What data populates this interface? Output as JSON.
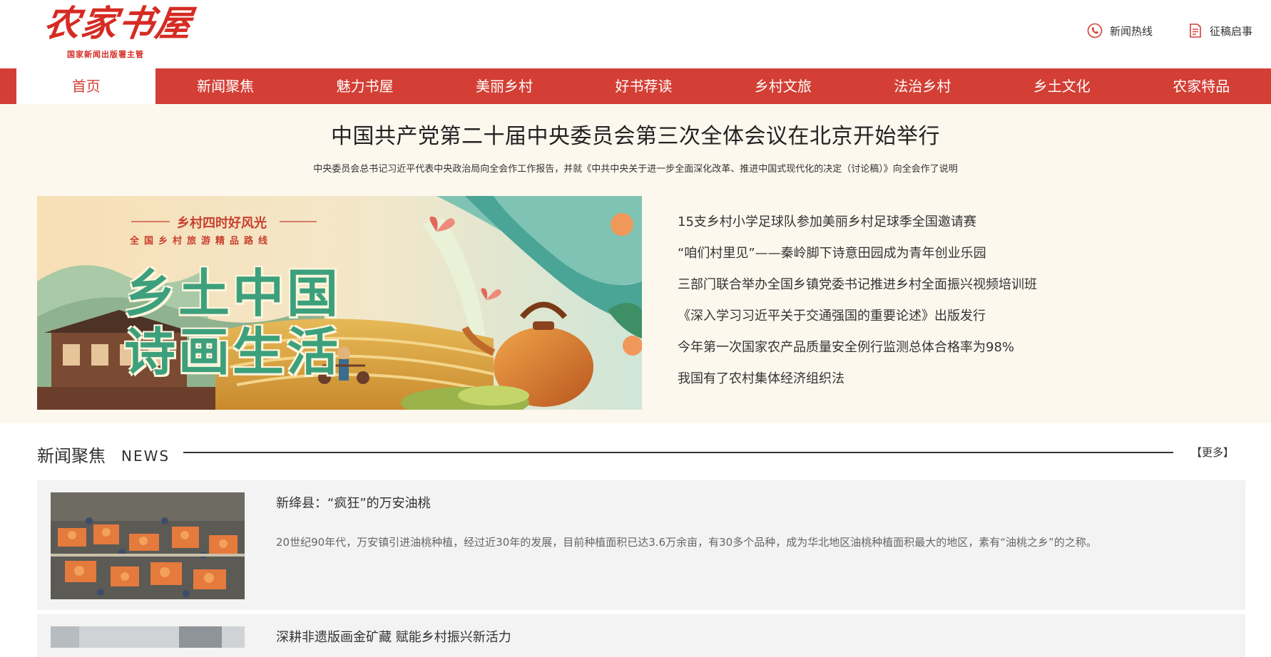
{
  "header": {
    "logo_text": "农家书屋",
    "logo_sub": "国家新闻出版署主管",
    "hotline_label": "新闻热线",
    "submission_label": "征稿启事"
  },
  "nav": {
    "items": [
      "首页",
      "新闻聚焦",
      "魅力书屋",
      "美丽乡村",
      "好书荐读",
      "乡村文旅",
      "法治乡村",
      "乡土文化",
      "农家特品"
    ],
    "active_index": 0
  },
  "headline": {
    "title": "中国共产党第二十届中央委员会第三次全体会议在北京开始举行",
    "subtitle": "中央委员会总书记习近平代表中央政治局向全会作工作报告，并就《中共中央关于进一步全面深化改革、推进中国式现代化的决定（讨论稿）》向全会作了说明"
  },
  "banner": {
    "tag_line": "乡村四时好风光",
    "tag_sub": "全国乡村旅游精品路线",
    "big_line1": "乡土中国",
    "big_line2": "诗画生活"
  },
  "top_news": [
    "15支乡村小学足球队参加美丽乡村足球季全国邀请赛",
    "“咱们村里见”——秦岭脚下诗意田园成为青年创业乐园",
    "三部门联合举办全国乡镇党委书记推进乡村全面振兴视频培训班",
    "《深入学习习近平关于交通强国的重要论述》出版发行",
    "今年第一次国家农产品质量安全例行监测总体合格率为98%",
    "我国有了农村集体经济组织法"
  ],
  "section": {
    "title": "新闻聚焦",
    "title_en": "NEWS",
    "more_label": "【更多】"
  },
  "articles": [
    {
      "title": "新绛县：“疯狂”的万安油桃",
      "desc": "20世纪90年代，万安镇引进油桃种植，经过近30年的发展，目前种植面积已达3.6万余亩，有30多个品种，成为华北地区油桃种植面积最大的地区，素有“油桃之乡”的之称。"
    },
    {
      "title": "深耕非遗版画金矿藏 赋能乡村振兴新活力"
    }
  ],
  "colors": {
    "brand_red": "#d33f35",
    "band_bg": "#fdf8ee",
    "card_bg": "#f3f3f3"
  }
}
